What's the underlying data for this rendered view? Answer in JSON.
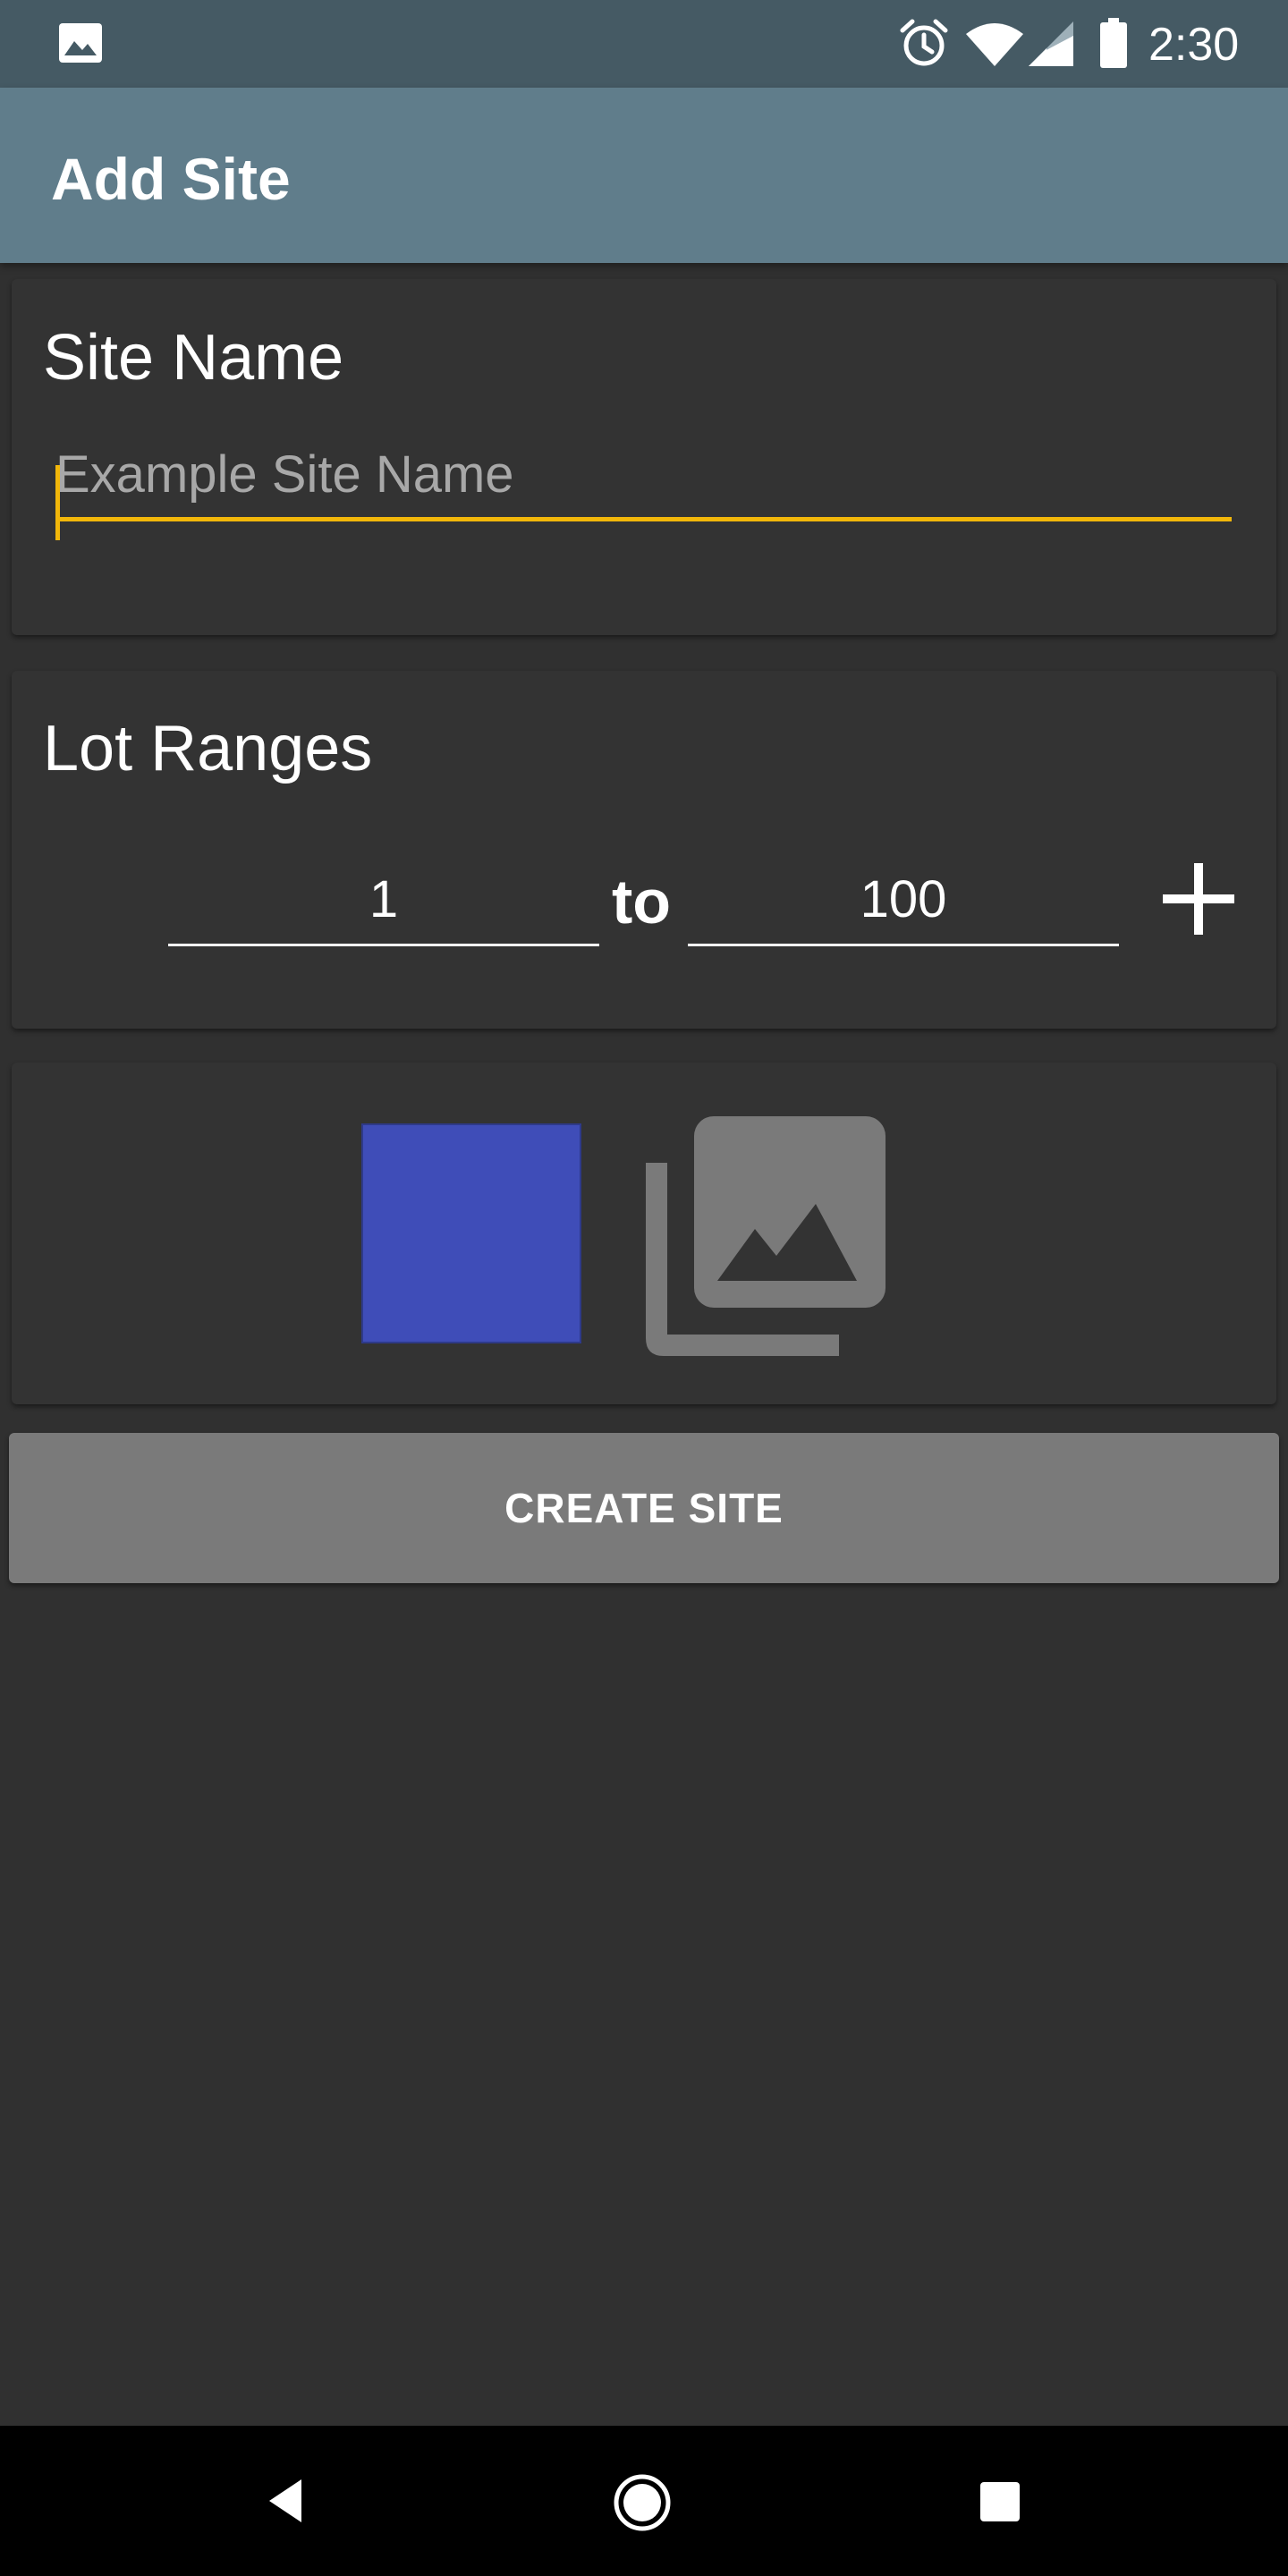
{
  "status_bar": {
    "time": "2:30",
    "icons": [
      "image-notification-icon",
      "alarm-icon",
      "wifi-icon",
      "cell-signal-icon",
      "battery-icon"
    ]
  },
  "app_bar": {
    "title": "Add Site"
  },
  "site_name_card": {
    "title": "Site Name",
    "input_value": "",
    "input_placeholder": "Example Site Name"
  },
  "lot_ranges_card": {
    "title": "Lot Ranges",
    "from_value": "1",
    "to_label": "to",
    "to_value": "100",
    "add_icon": "plus-icon"
  },
  "appearance_card": {
    "color_swatch_color": "#3f4db8",
    "gallery_icon": "photo-library-icon"
  },
  "create_button": {
    "label": "CREATE SITE"
  },
  "nav_bar": {
    "icons": [
      "back-icon",
      "home-icon",
      "recents-icon"
    ]
  },
  "colors": {
    "status_bar": "#455a64",
    "app_bar": "#607d8b",
    "background": "#303030",
    "card": "#333333",
    "accent": "#f2b70a",
    "button": "#7a7a7a",
    "icon_grey": "#7a7a7a"
  }
}
